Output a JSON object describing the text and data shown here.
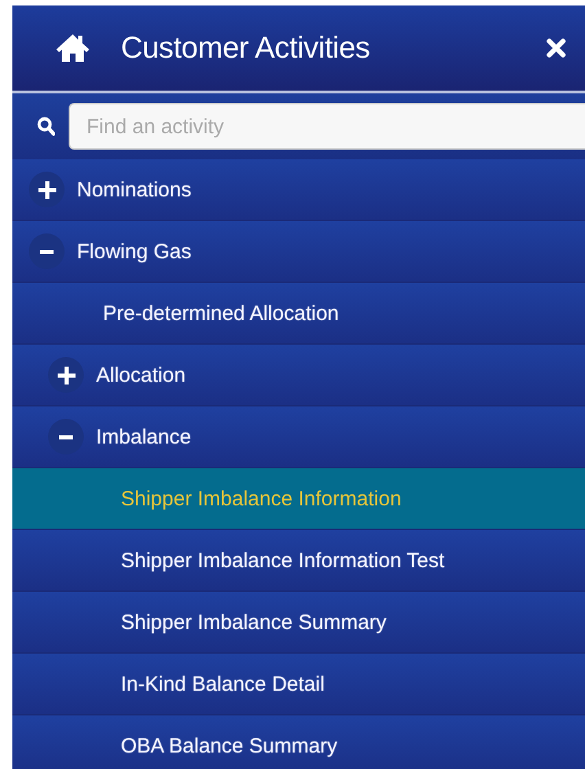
{
  "header": {
    "title": "Customer Activities"
  },
  "search": {
    "placeholder": "Find an activity"
  },
  "tree": [
    {
      "label": "Nominations",
      "expanded": false,
      "selected": false
    },
    {
      "label": "Flowing Gas",
      "expanded": true,
      "selected": false,
      "children": [
        {
          "label": "Pre-determined Allocation",
          "selected": false
        },
        {
          "label": "Allocation",
          "expanded": false,
          "selected": false
        },
        {
          "label": "Imbalance",
          "expanded": true,
          "selected": false,
          "children": [
            {
              "label": "Shipper Imbalance Information",
              "selected": true
            },
            {
              "label": "Shipper Imbalance Information Test",
              "selected": false
            },
            {
              "label": "Shipper Imbalance Summary",
              "selected": false
            },
            {
              "label": "In-Kind Balance Detail",
              "selected": false
            },
            {
              "label": "OBA Balance Summary",
              "selected": false
            }
          ]
        }
      ]
    }
  ]
}
